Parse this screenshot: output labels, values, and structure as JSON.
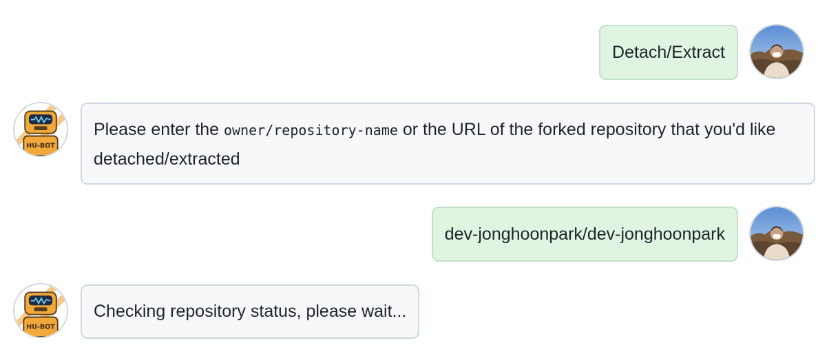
{
  "messages": [
    {
      "sender": "user",
      "text": "Detach/Extract"
    },
    {
      "sender": "bot",
      "text_before": "Please enter the ",
      "code": "owner/repository-name",
      "text_after": " or the URL of the forked repository that you'd like detached/extracted"
    },
    {
      "sender": "user",
      "text": "dev-jonghoonpark/dev-jonghoonpark"
    },
    {
      "sender": "bot",
      "text": "Checking repository status, please wait..."
    }
  ],
  "bot_avatar": {
    "label": "HU-BOT",
    "icon": "robot-icon"
  },
  "user_avatar": {
    "icon": "user-photo"
  },
  "colors": {
    "user_bubble_bg": "#dff5e2",
    "user_bubble_border": "#c6dfc9",
    "bot_bubble_bg": "#f6f8fa",
    "bot_bubble_border": "#d0d7de",
    "bot_avatar_orange": "#f2a93b"
  }
}
